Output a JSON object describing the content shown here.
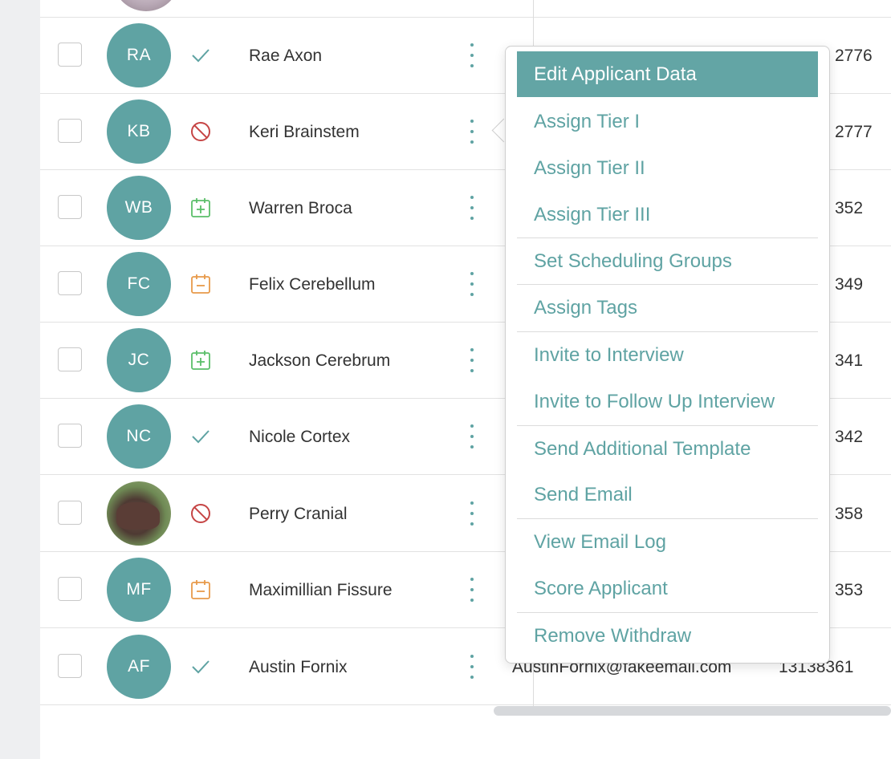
{
  "colors": {
    "accent": "#5fa3a3",
    "blocked": "#c64545",
    "scheduled_add": "#5bbf6a",
    "scheduled_remove": "#e89a4a"
  },
  "rows": [
    {
      "initials": "RA",
      "name": "Rae Axon",
      "status_icon": "check-icon",
      "right_text": "2776"
    },
    {
      "initials": "KB",
      "name": "Keri Brainstem",
      "status_icon": "blocked-icon",
      "right_text": "2777"
    },
    {
      "initials": "WB",
      "name": "Warren Broca",
      "status_icon": "calendar-add-icon",
      "right_text": "352"
    },
    {
      "initials": "FC",
      "name": "Felix Cerebellum",
      "status_icon": "calendar-remove-icon",
      "right_text": "349"
    },
    {
      "initials": "JC",
      "name": "Jackson Cerebrum",
      "status_icon": "calendar-add-icon",
      "right_text": "341"
    },
    {
      "initials": "NC",
      "name": "Nicole Cortex",
      "status_icon": "check-icon",
      "right_text": "342"
    },
    {
      "initials": "",
      "name": "Perry Cranial",
      "status_icon": "blocked-icon",
      "right_text": "358"
    },
    {
      "initials": "MF",
      "name": "Maximillian Fissure",
      "status_icon": "calendar-remove-icon",
      "right_text": "353"
    },
    {
      "initials": "AF",
      "name": "Austin Fornix",
      "status_icon": "check-icon",
      "email": "AustinFornix@fakeemail.com",
      "phone": "13138361"
    }
  ],
  "menu": {
    "items": [
      "Edit Applicant Data",
      "Assign Tier I",
      "Assign Tier II",
      "Assign Tier III",
      "Set Scheduling Groups",
      "Assign Tags",
      "Invite to Interview",
      "Invite to Follow Up Interview",
      "Send Additional Template",
      "Send Email",
      "View Email Log",
      "Score Applicant",
      "Remove Withdraw"
    ],
    "active_item": "Edit Applicant Data"
  }
}
